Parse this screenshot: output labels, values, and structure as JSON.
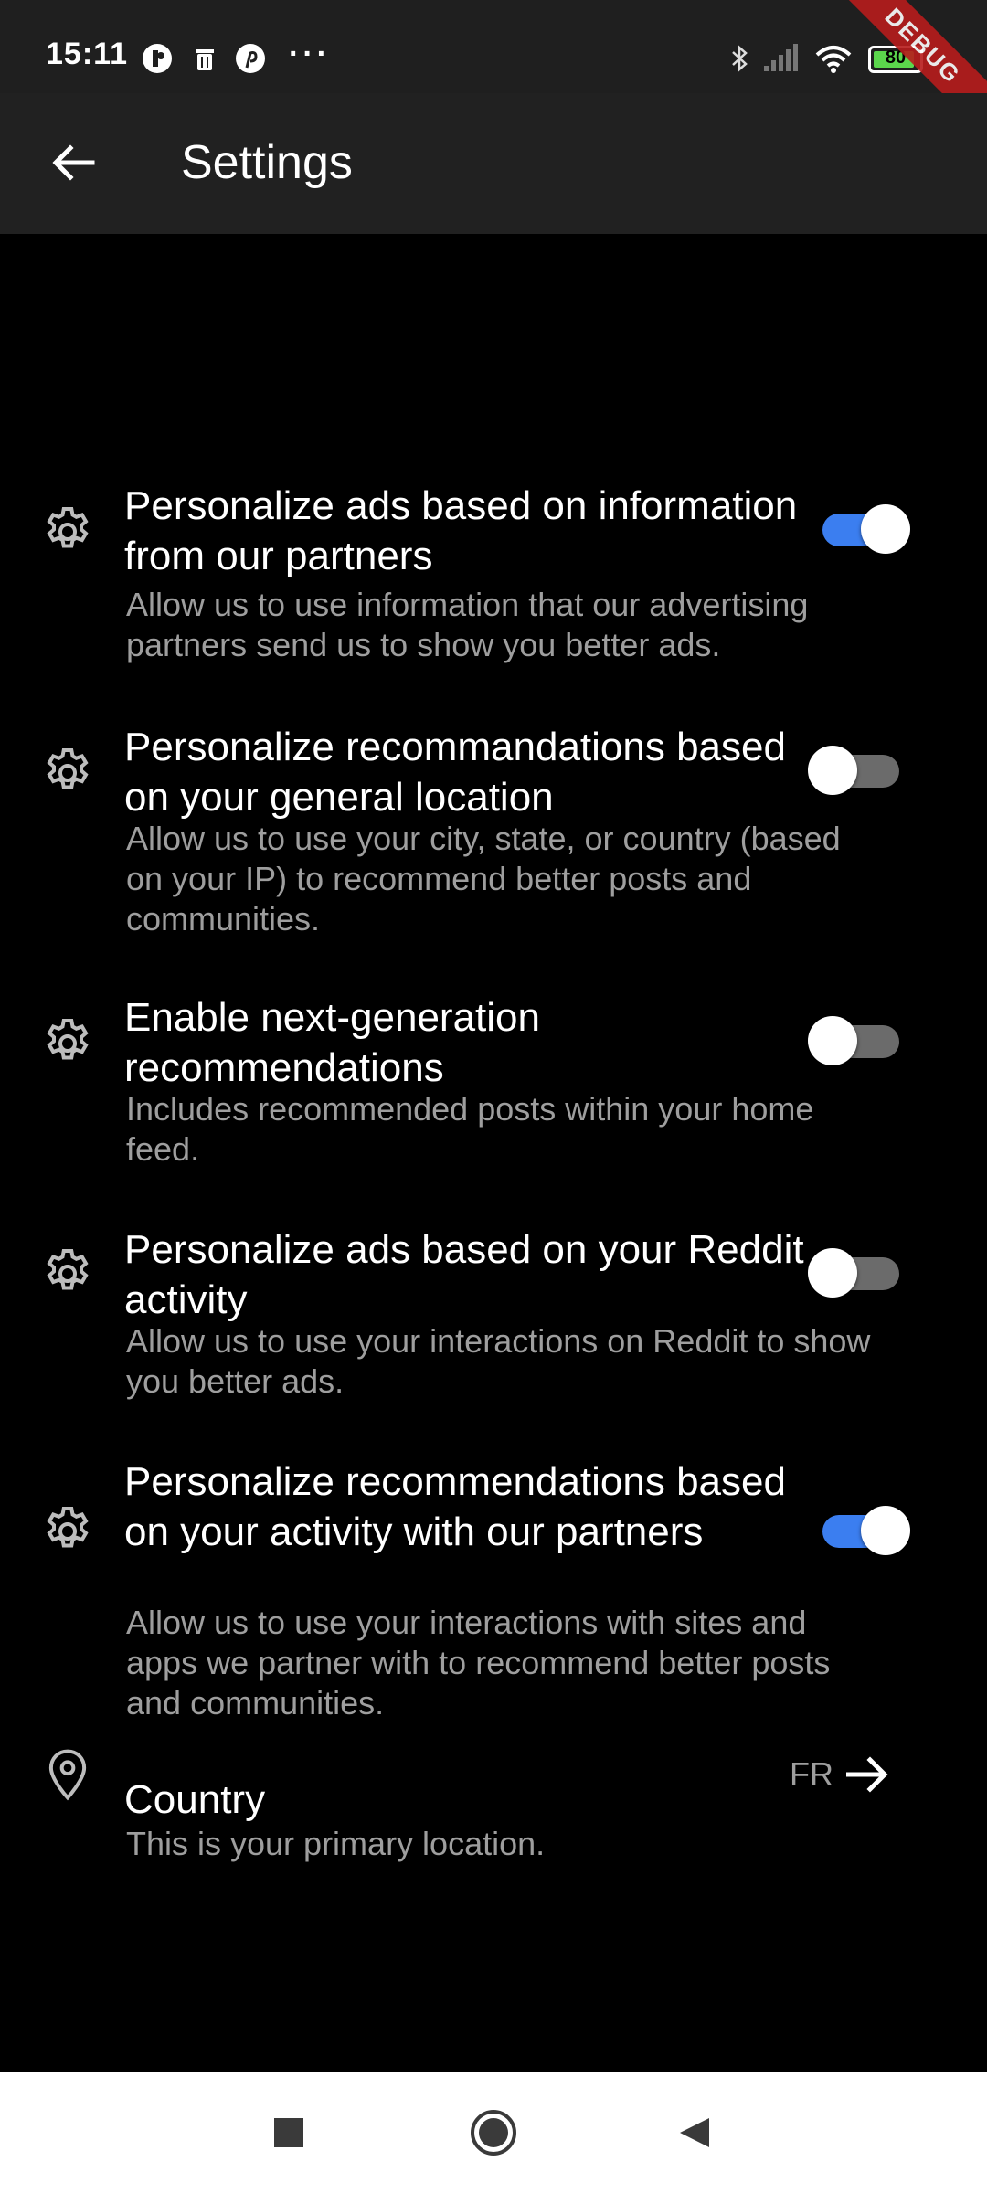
{
  "status_bar": {
    "time": "15:11",
    "more": "···",
    "battery": "80",
    "debug": "DEBUG"
  },
  "app_bar": {
    "title": "Settings"
  },
  "settings": [
    {
      "title": "Personalize ads based on information from our partners",
      "subtitle": "Allow us to use information that our advertising partners send us to show you better ads.",
      "enabled": true
    },
    {
      "title": "Personalize recommandations based on your general location",
      "subtitle": "Allow us to use your city, state, or country (based on your IP) to recommend better posts and communities.",
      "enabled": false
    },
    {
      "title": "Enable next-generation recommendations",
      "subtitle": "Includes recommended posts within your home feed.",
      "enabled": false
    },
    {
      "title": "Personalize ads based on your Reddit activity",
      "subtitle": "Allow us to use your interactions on Reddit to show you better ads.",
      "enabled": false
    },
    {
      "title": "Personalize recommendations based on your activity with our partners",
      "subtitle": "Allow us to use your interactions with sites and apps we partner with to recommend better posts and communities.",
      "enabled": true
    }
  ],
  "country": {
    "title": "Country",
    "subtitle": "This is your primary location.",
    "value": "FR"
  },
  "colors": {
    "toggle_on": "#3b7ef0",
    "toggle_off": "#6b6b6b",
    "subtitle": "#9e9e9e",
    "app_bar": "#212121"
  }
}
